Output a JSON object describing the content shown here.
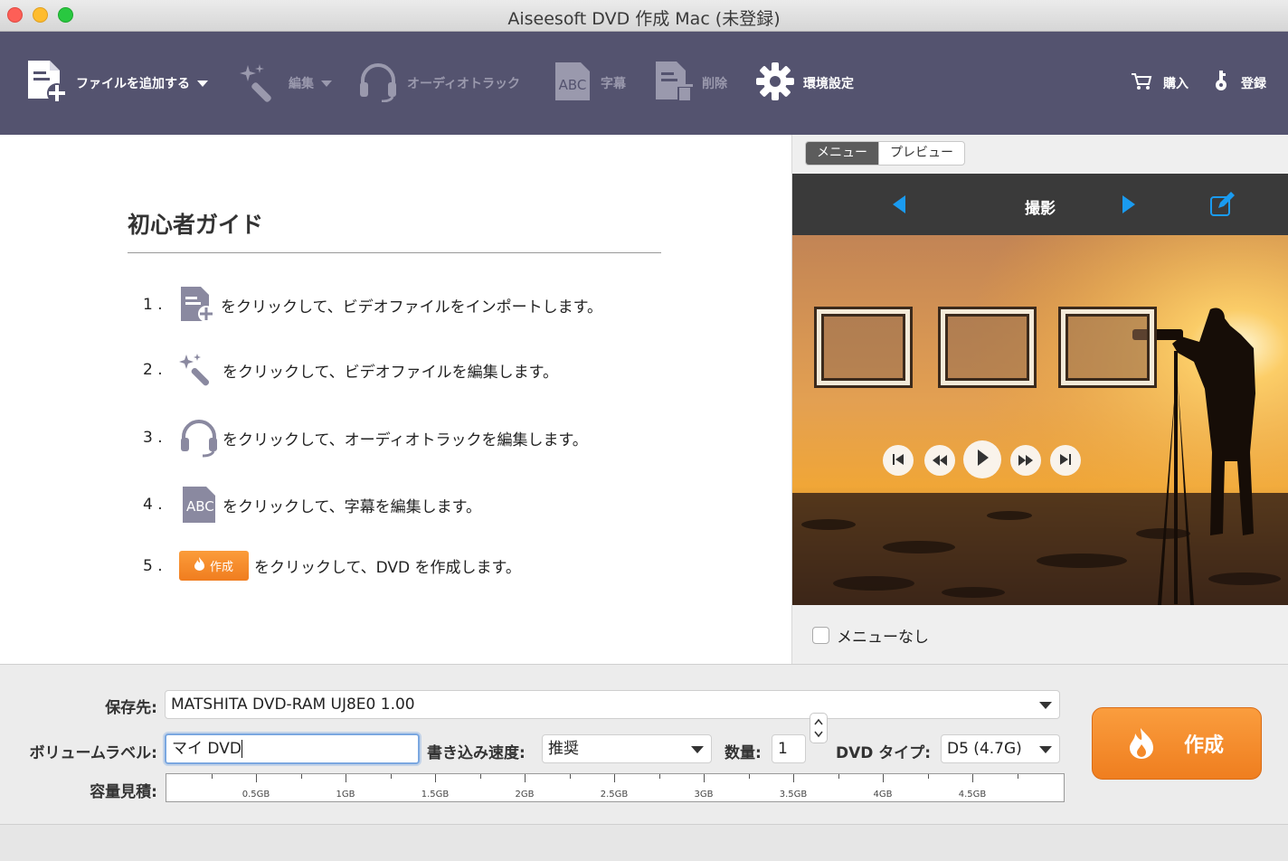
{
  "window": {
    "title": "Aiseesoft DVD 作成 Mac (未登録)"
  },
  "toolbar": {
    "add_file": "ファイルを追加する",
    "edit": "編集",
    "audio_track": "オーディオトラック",
    "subtitle": "字幕",
    "delete": "削除",
    "preferences": "環境設定",
    "buy": "購入",
    "register": "登録"
  },
  "guide": {
    "title": "初心者ガイド",
    "steps": [
      {
        "num": "1 .",
        "text": "をクリックして、ビデオファイルをインポートします。"
      },
      {
        "num": "2 .",
        "text": "をクリックして、ビデオファイルを編集します。"
      },
      {
        "num": "3 .",
        "text": "をクリックして、オーディオトラックを編集します。"
      },
      {
        "num": "4 .",
        "text": "をクリックして、字幕を編集します。"
      },
      {
        "num": "5 .",
        "text": "をクリックして、DVD を作成します。"
      }
    ],
    "create_chip": "作成",
    "abc_icon": "ABC"
  },
  "menu_panel": {
    "tab_menu": "メニュー",
    "tab_preview": "プレビュー",
    "template_name": "撮影",
    "no_menu": "メニューなし"
  },
  "output": {
    "destination_label": "保存先:",
    "destination_value": "MATSHITA DVD-RAM UJ8E0 1.00",
    "volume_label": "ボリュームラベル:",
    "volume_value": "マイ DVD",
    "speed_label": "書き込み速度:",
    "speed_value": "推奨",
    "quantity_label": "数量:",
    "quantity_value": "1",
    "dvd_type_label": "DVD タイプ:",
    "dvd_type_value": "D5 (4.7G)",
    "capacity_label": "容量見積:",
    "capacity_ticks": [
      "0.5GB",
      "1GB",
      "1.5GB",
      "2GB",
      "2.5GB",
      "3GB",
      "3.5GB",
      "4GB",
      "4.5GB"
    ],
    "create_button": "作成"
  },
  "colors": {
    "toolbar_bg": "#54536f",
    "accent_orange": "#f58a2a",
    "nav_blue": "#1a9bf0"
  }
}
